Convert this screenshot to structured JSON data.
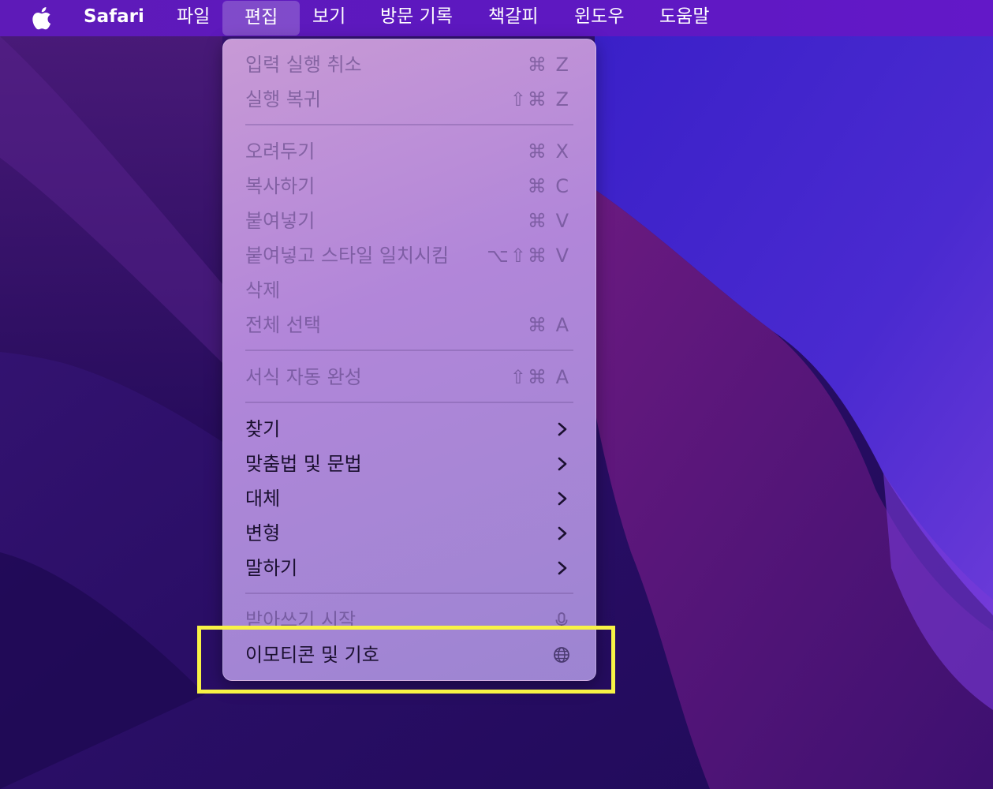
{
  "menubar": {
    "app_name": "Safari",
    "items": [
      "파일",
      "편집",
      "보기",
      "방문 기록",
      "책갈피",
      "윈도우",
      "도움말"
    ],
    "active_item": "편집"
  },
  "edit_menu": {
    "items": [
      {
        "label": "입력 실행 취소",
        "shortcut": "⌘ Z",
        "enabled": false
      },
      {
        "label": "실행 복귀",
        "shortcut": "⇧⌘ Z",
        "enabled": false
      },
      {
        "label": "오려두기",
        "shortcut": "⌘ X",
        "enabled": false
      },
      {
        "label": "복사하기",
        "shortcut": "⌘ C",
        "enabled": false
      },
      {
        "label": "붙여넣기",
        "shortcut": "⌘ V",
        "enabled": false
      },
      {
        "label": "붙여넣고 스타일 일치시킴",
        "shortcut": "⌥⇧⌘ V",
        "enabled": false
      },
      {
        "label": "삭제",
        "shortcut": "",
        "enabled": false
      },
      {
        "label": "전체 선택",
        "shortcut": "⌘ A",
        "enabled": false
      },
      {
        "label": "서식 자동 완성",
        "shortcut": "⇧⌘ A",
        "enabled": false
      },
      {
        "label": "찾기",
        "submenu": true,
        "enabled": true
      },
      {
        "label": "맞춤법 및 문법",
        "submenu": true,
        "enabled": true
      },
      {
        "label": "대체",
        "submenu": true,
        "enabled": true
      },
      {
        "label": "변형",
        "submenu": true,
        "enabled": true
      },
      {
        "label": "말하기",
        "submenu": true,
        "enabled": true
      },
      {
        "label": "받아쓰기 시작",
        "icon": "microphone-icon",
        "enabled": false
      },
      {
        "label": "이모티콘 및 기호",
        "icon": "globe-icon",
        "enabled": true
      }
    ]
  },
  "colors": {
    "highlight_box": "#f8f245",
    "menubar": "#5e1ab8"
  }
}
